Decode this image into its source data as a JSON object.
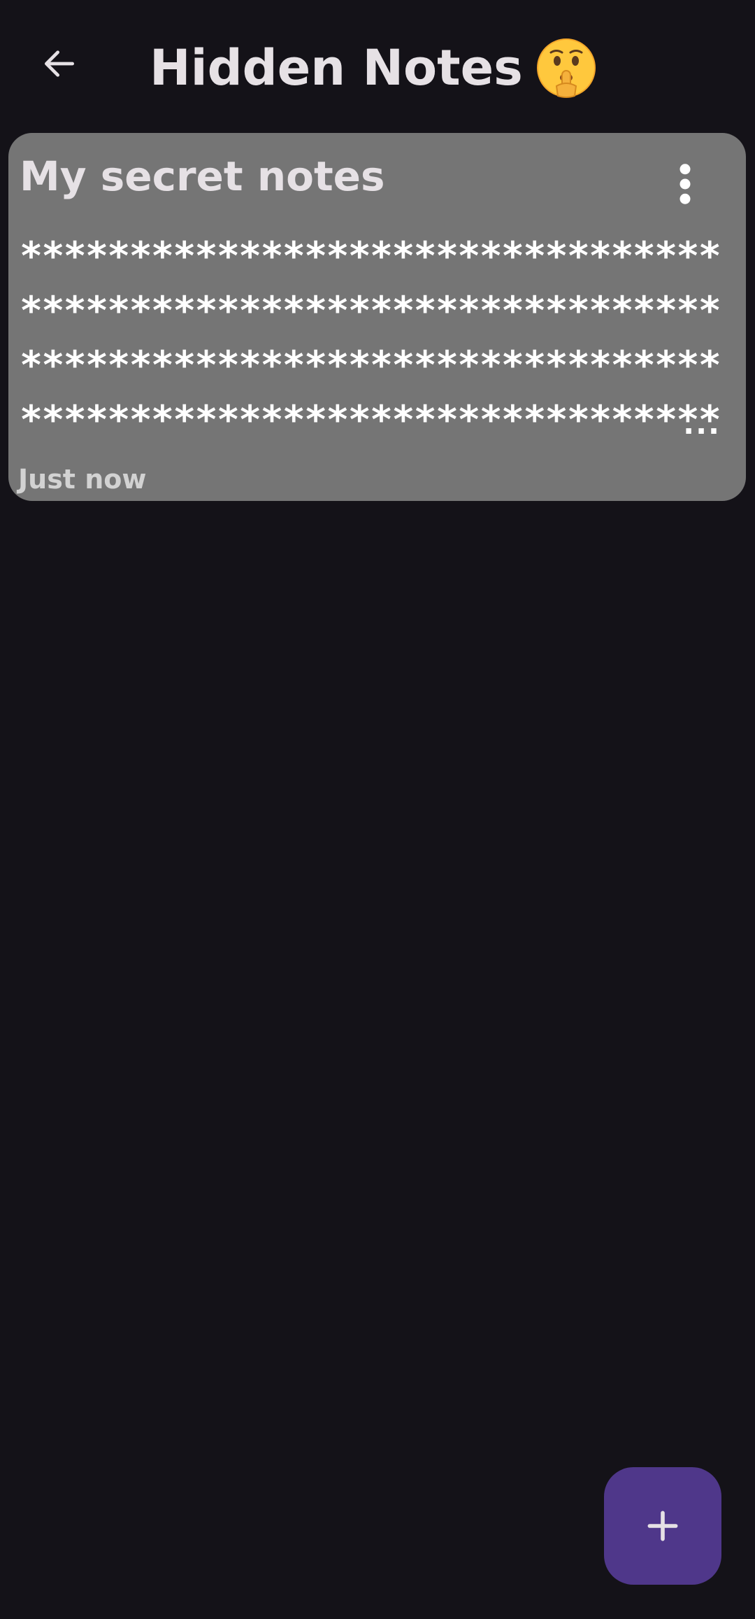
{
  "header": {
    "title": "Hidden Notes",
    "title_emoji_icon": "shushing-face-icon",
    "back_icon": "arrow-left-icon"
  },
  "notes": [
    {
      "title": "My secret notes",
      "content": "***********************************************************************************************************************************************",
      "ellipsis": "...",
      "time": "Just now",
      "menu_icon": "more-vertical-icon"
    }
  ],
  "fab": {
    "icon": "plus-icon"
  },
  "colors": {
    "background": "#141218",
    "card": "#757575",
    "fab": "#4F378A",
    "text_primary": "#E6E1E5",
    "text_secondary": "#D2D2D2"
  }
}
